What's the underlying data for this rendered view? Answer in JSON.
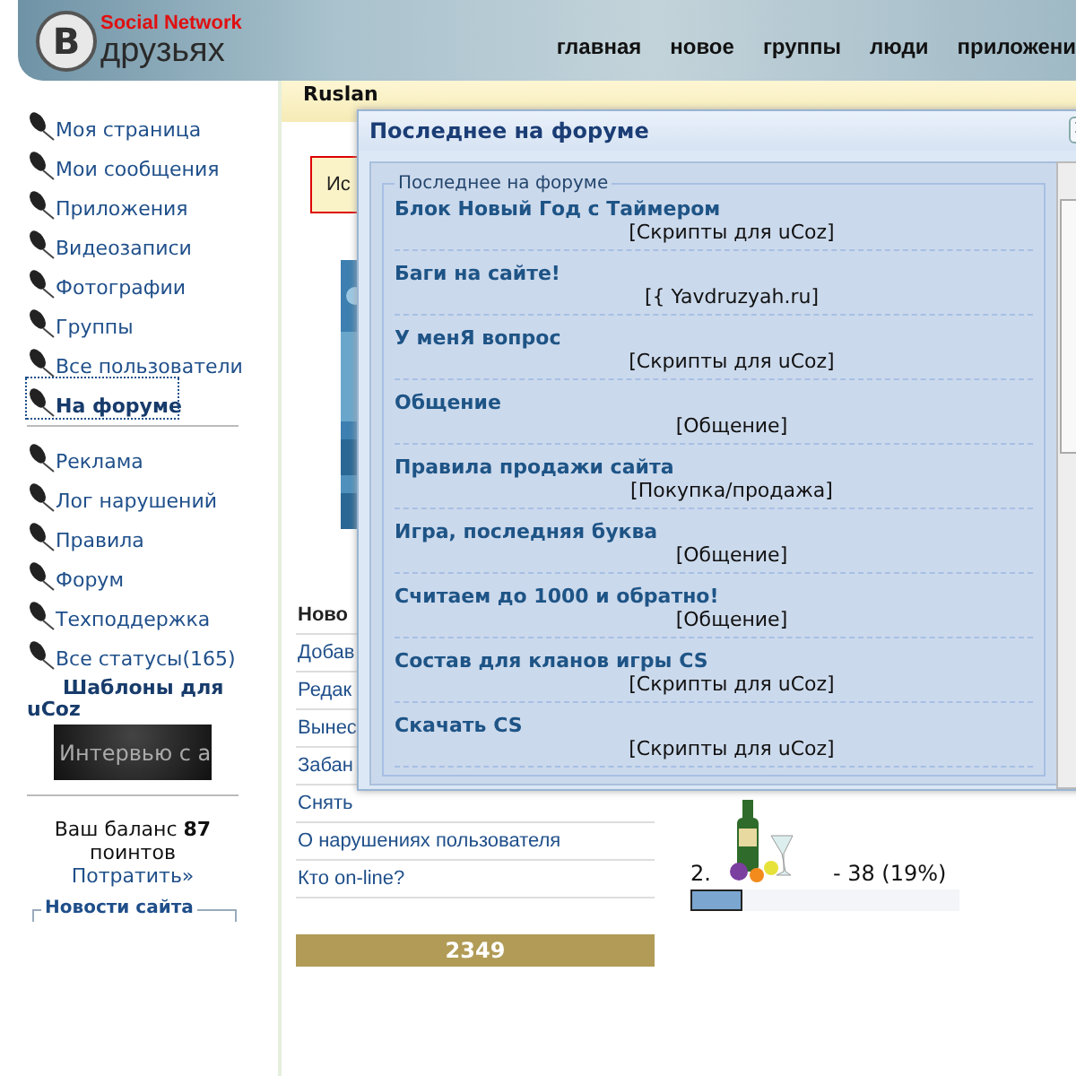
{
  "header": {
    "logo": {
      "tagline": "Social Network",
      "letter": "В",
      "name": "друзьях"
    },
    "nav": [
      "главная",
      "новое",
      "группы",
      "люди",
      "приложени"
    ]
  },
  "sidebar": {
    "menu_groups": [
      [
        {
          "label": "Моя страница",
          "selected": false,
          "bold": false
        },
        {
          "label": "Мои сообщения",
          "selected": false,
          "bold": false
        },
        {
          "label": "Приложения",
          "selected": false,
          "bold": false
        },
        {
          "label": "Видеозаписи",
          "selected": false,
          "bold": false
        },
        {
          "label": "Фотографии",
          "selected": false,
          "bold": false
        },
        {
          "label": "Группы",
          "selected": false,
          "bold": false
        },
        {
          "label": "Все пользователи",
          "selected": false,
          "bold": false
        },
        {
          "label": "На форуме",
          "selected": true,
          "bold": true
        }
      ],
      [
        {
          "label": "Реклама",
          "selected": false,
          "bold": false
        },
        {
          "label": "Лог нарушений",
          "selected": false,
          "bold": false
        },
        {
          "label": "Правила",
          "selected": false,
          "bold": false
        },
        {
          "label": "Форум",
          "selected": false,
          "bold": false
        },
        {
          "label": "Техподдержка",
          "selected": false,
          "bold": false
        },
        {
          "label": "Все статусы(165)",
          "selected": false,
          "bold": false
        },
        {
          "label": "Шаблоны для uCoz",
          "selected": false,
          "bold": true
        }
      ]
    ],
    "banner": "Интервью с а",
    "balance": {
      "text": "Ваш баланс **87**",
      "unit": "поинтов",
      "link": "Потратить»"
    },
    "news_legend": "Новости сайта"
  },
  "profile": {
    "name": "Ruslan"
  },
  "notice": "Ис",
  "actions": {
    "heading": "Ново",
    "items": [
      "Добав",
      "Редак",
      "Вынес",
      "Забан",
      "Снять",
      "О нарушениях пользователя",
      "Кто on-line?"
    ]
  },
  "counter": "2349",
  "poll": {
    "number": "2.",
    "result": "- 38 (19%)",
    "level": 0.19
  },
  "popup": {
    "title": "Последнее на форуме",
    "legend": "Последнее на форуме",
    "topics": [
      {
        "title": "Блок Новый Год с Таймером",
        "forum": "[Скрипты для uCoz]"
      },
      {
        "title": "Баги на сайте!",
        "forum": "[{ Yavdruzyah.ru]"
      },
      {
        "title": "У менЯ вопрос",
        "forum": "[Скрипты для uCoz]"
      },
      {
        "title": "Общение",
        "forum": "[Общение]"
      },
      {
        "title": "Правила продажи сайта",
        "forum": "[Покупка/продажа]"
      },
      {
        "title": "Игра, последняя буква",
        "forum": "[Общение]"
      },
      {
        "title": "Считаем до 1000 и обратно!",
        "forum": "[Общение]"
      },
      {
        "title": "Состав для кланов игры CS",
        "forum": "[Скрипты для uCoz]"
      },
      {
        "title": "Скачать CS",
        "forum": "[Скрипты для uCoz]"
      }
    ]
  }
}
